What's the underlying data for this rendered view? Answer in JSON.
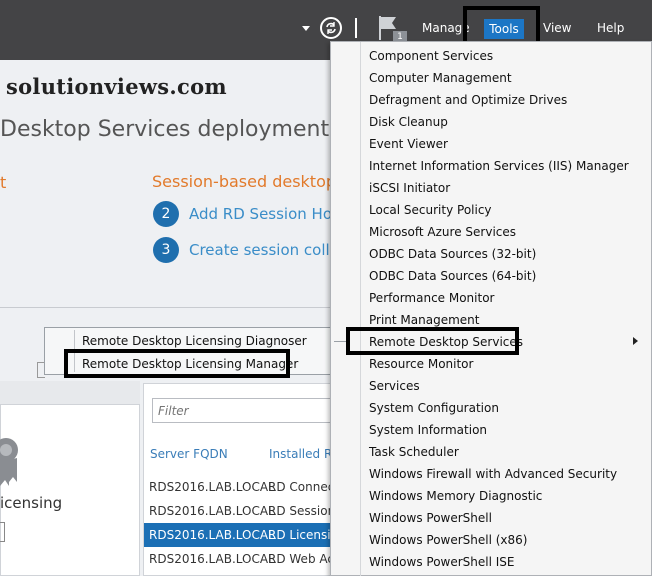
{
  "header": {
    "menu": {
      "manage": "Manage",
      "tools": "Tools",
      "view": "View",
      "help": "Help"
    },
    "notification_count": "1"
  },
  "watermark": "solutionviews.com",
  "main": {
    "title": "Desktop Services deployment",
    "orange_fragment": "t",
    "section_title": "Session-based desktop",
    "steps": [
      {
        "number": "2",
        "label": "Add RD Session Hos"
      },
      {
        "number": "3",
        "label": "Create session colle"
      }
    ]
  },
  "context_menu": {
    "items": [
      "Remote Desktop Licensing Diagnoser",
      "Remote Desktop Licensing Manager"
    ]
  },
  "left_panel": {
    "label": "icensing"
  },
  "servers_panel": {
    "filter_placeholder": "Filter",
    "columns": [
      "Server FQDN",
      "Installed Ro"
    ],
    "rows": [
      {
        "fqdn": "RDS2016.LAB.LOCAL",
        "role": "RD Connect",
        "selected": false
      },
      {
        "fqdn": "RDS2016.LAB.LOCAL",
        "role": "RD Session",
        "selected": false
      },
      {
        "fqdn": "RDS2016.LAB.LOCAL",
        "role": "RD Licensin",
        "selected": true
      },
      {
        "fqdn": "RDS2016.LAB.LOCAL",
        "role": "RD Web Acc",
        "selected": false
      }
    ]
  },
  "tools_menu": {
    "items": [
      "Component Services",
      "Computer Management",
      "Defragment and Optimize Drives",
      "Disk Cleanup",
      "Event Viewer",
      "Internet Information Services (IIS) Manager",
      "iSCSI Initiator",
      "Local Security Policy",
      "Microsoft Azure Services",
      "ODBC Data Sources (32-bit)",
      "ODBC Data Sources (64-bit)",
      "Performance Monitor",
      "Print Management",
      "Remote Desktop Services",
      "Resource Monitor",
      "Services",
      "System Configuration",
      "System Information",
      "Task Scheduler",
      "Windows Firewall with Advanced Security",
      "Windows Memory Diagnostic",
      "Windows PowerShell",
      "Windows PowerShell (x86)",
      "Windows PowerShell ISE"
    ]
  },
  "colors": {
    "topbar": "#444446",
    "accent": "#1c76c5",
    "orange": "#e27a2b",
    "link": "#3a8dc8"
  }
}
